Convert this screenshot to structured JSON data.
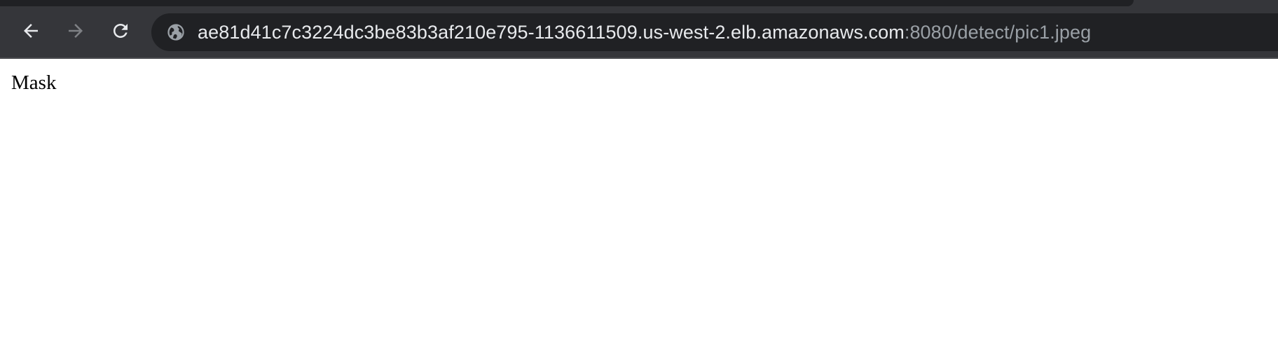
{
  "browser": {
    "url_host": "ae81d41c7c3224dc3be83b3af210e795-1136611509.us-west-2.elb.amazonaws.com",
    "url_rest": ":8080/detect/pic1.jpeg",
    "icons": {
      "back": "arrow-left-icon",
      "forward": "arrow-right-icon",
      "reload": "reload-icon",
      "site_info": "globe-icon"
    },
    "colors": {
      "toolbar": "#35363a",
      "omnibox": "#202124",
      "url_host": "#e8eaed",
      "url_rest": "#9aa0a6"
    }
  },
  "page": {
    "text": "Mask"
  }
}
